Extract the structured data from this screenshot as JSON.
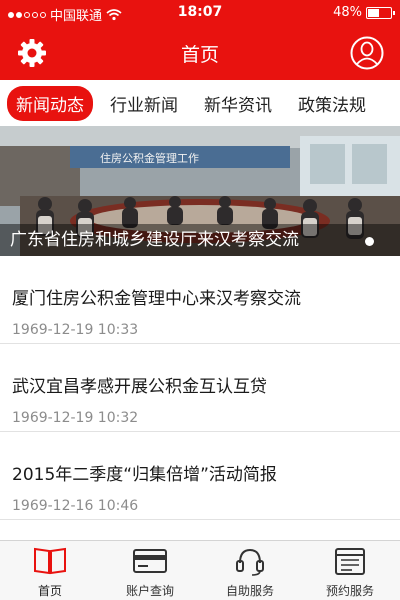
{
  "status_bar": {
    "carrier": "中国联通",
    "time": "18:07",
    "battery_text": "48%",
    "battery_level": 0.48
  },
  "header": {
    "title": "首页"
  },
  "tabs": [
    {
      "label": "新闻动态",
      "active": true
    },
    {
      "label": "行业新闻",
      "active": false
    },
    {
      "label": "新华资讯",
      "active": false
    },
    {
      "label": "政策法规",
      "active": false
    }
  ],
  "banner": {
    "caption": "广东省住房和城乡建设厅来汉考察交流",
    "image_sign_text": "住房公积金管理工作",
    "slide_count": 1,
    "active_slide": 1
  },
  "news": [
    {
      "title": "厦门住房公积金管理中心来汉考察交流",
      "time": "1969-12-19 10:33"
    },
    {
      "title": "武汉宜昌孝感开展公积金互认互贷",
      "time": "1969-12-19 10:32"
    },
    {
      "title": "2015年二季度“归集倍增”活动简报",
      "time": "1969-12-16 10:46"
    }
  ],
  "bottom_nav": [
    {
      "label": "首页",
      "icon": "book-icon",
      "active": true
    },
    {
      "label": "账户查询",
      "icon": "card-icon",
      "active": false
    },
    {
      "label": "自助服务",
      "icon": "headset-icon",
      "active": false
    },
    {
      "label": "预约服务",
      "icon": "calendar-icon",
      "active": false
    }
  ],
  "colors": {
    "brand_red": "#e8120f",
    "text_dark": "#1a1a1a",
    "text_muted": "#8c8c8c"
  }
}
